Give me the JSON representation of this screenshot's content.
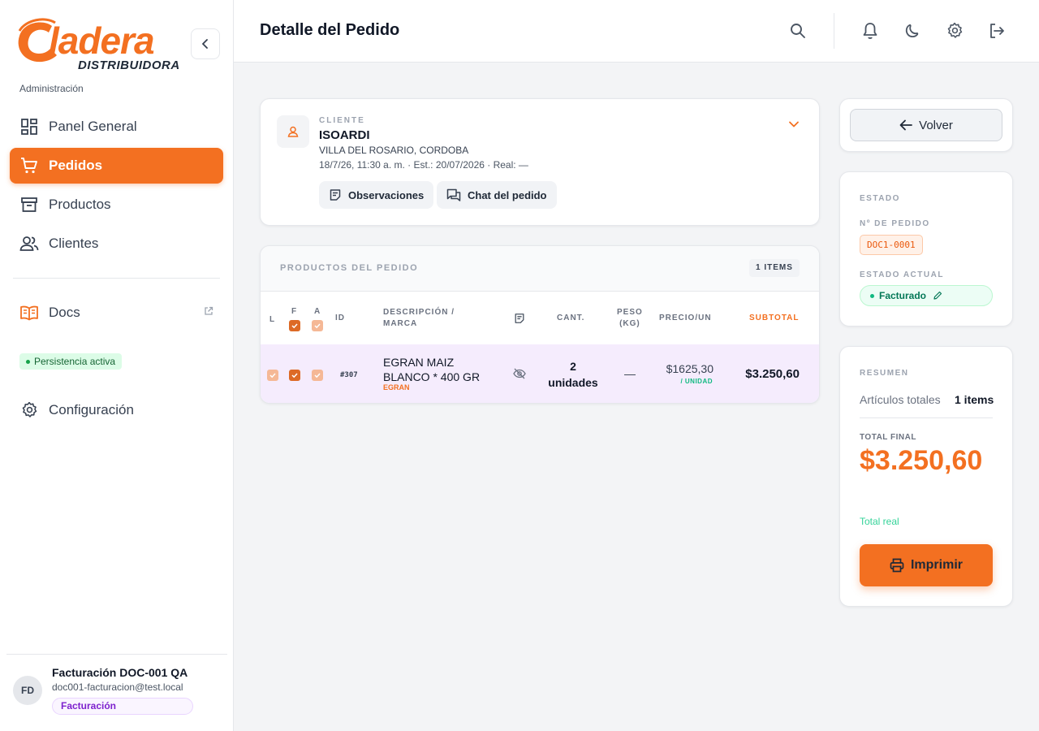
{
  "brand": {
    "name": "Cladera",
    "word": "ladera",
    "sub": "DISTRIBUIDORA",
    "section": "Administración",
    "accent": "#f37021"
  },
  "sidebar": {
    "items": [
      {
        "label": "Panel General",
        "icon": "dashboard-icon"
      },
      {
        "label": "Pedidos",
        "icon": "cart-icon",
        "active": true
      },
      {
        "label": "Productos",
        "icon": "archive-box-icon"
      },
      {
        "label": "Clientes",
        "icon": "users-icon"
      }
    ],
    "docs": {
      "label": "Docs",
      "icon": "book-icon"
    },
    "persistence": "Persistencia activa",
    "config": {
      "label": "Configuración",
      "icon": "gear-icon"
    }
  },
  "user": {
    "initials": "FD",
    "name": "Facturación DOC-001 QA",
    "email": "doc001-facturacion@test.local",
    "role": "Facturación"
  },
  "header": {
    "title": "Detalle del Pedido"
  },
  "client": {
    "label": "CLIENTE",
    "name": "ISOARDI",
    "location": "VILLA DEL ROSARIO, CORDOBA",
    "dates": "18/7/26, 11:30 a. m. · Est.: 20/07/2026 · Real: —",
    "observations_label": "Observaciones",
    "chat_label": "Chat del pedido"
  },
  "products": {
    "title": "PRODUCTOS DEL PEDIDO",
    "count_badge": "1 ITEMS",
    "columns": {
      "l": "L",
      "f": "F",
      "a": "A",
      "id": "ID",
      "description_1": "DESCRIPCIÓN /",
      "description_2": "MARCA",
      "qty": "CANT.",
      "weight_1": "PESO",
      "weight_2": "(KG)",
      "price": "PRECIO/UN",
      "subtotal": "SUBTOTAL"
    },
    "rows": [
      {
        "id": "#307",
        "description_1": "EGRAN MAIZ",
        "description_2": "BLANCO * 400 GR",
        "brand": "EGRAN",
        "qty_1": "2",
        "qty_2": "unidades",
        "weight": "—",
        "price": "$1625,30",
        "price_unit": "/ UNIDAD",
        "subtotal": "$3.250,60"
      }
    ]
  },
  "actions": {
    "back_label": "Volver",
    "print_label": "Imprimir"
  },
  "estado": {
    "title": "ESTADO",
    "order_label": "Nº DE PEDIDO",
    "order_number": "DOC1-0001",
    "status_label": "ESTADO ACTUAL",
    "status": "Facturado"
  },
  "resumen": {
    "title": "RESUMEN",
    "items_label": "Artículos totales",
    "items_value": "1 items",
    "total_label": "TOTAL FINAL",
    "total_value": "$3.250,60",
    "total_note": "Total real"
  }
}
